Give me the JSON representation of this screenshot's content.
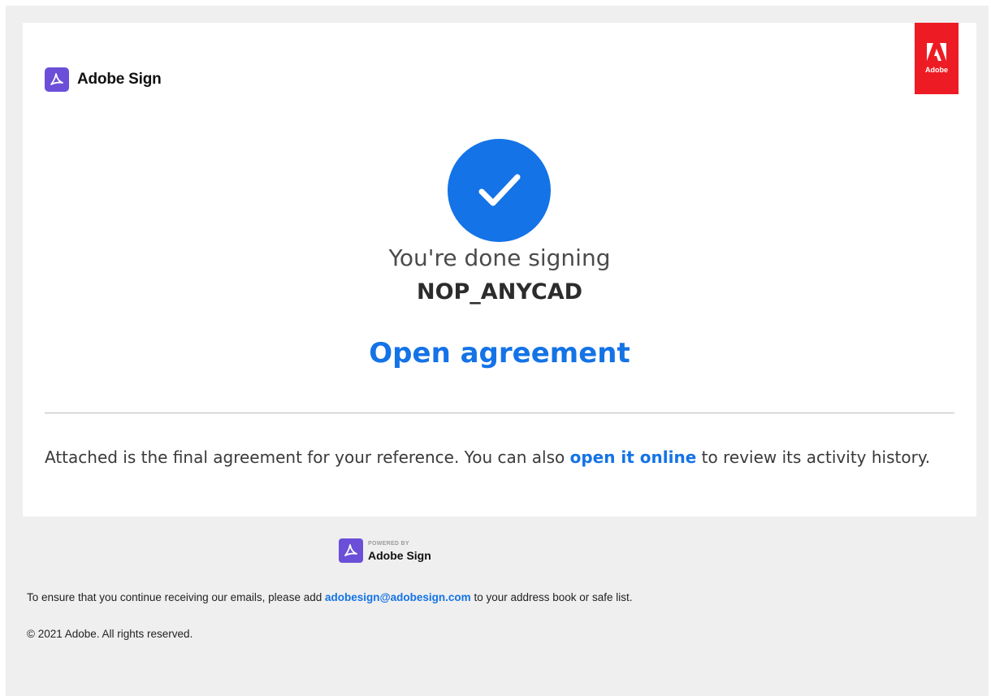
{
  "header": {
    "brand_name": "Adobe Sign",
    "brand_icon": "acrobat-sign-icon",
    "logo_text": "Adobe",
    "logo_icon": "adobe-logo-icon"
  },
  "main": {
    "status_icon": "check-circle-icon",
    "done_text": "You're done signing",
    "agreement_name": "NOP_ANYCAD",
    "open_agreement_label": "Open agreement",
    "message_prefix": "Attached is the final agreement for your reference. You can also",
    "message_link": "open it online",
    "message_suffix": "to review its activity history."
  },
  "footer": {
    "powered_by": "POWERED BY",
    "powered_name": "Adobe Sign",
    "note_prefix": "To ensure that you continue receiving our emails, please add",
    "note_email": "adobesign@adobesign.com",
    "note_suffix": "to your address book or safe list.",
    "copyright": "© 2021 Adobe. All rights reserved."
  },
  "colors": {
    "accent": "#1473e6",
    "brand_purple": "#6b4fd8",
    "adobe_red": "#ed1c24",
    "background": "#efefef"
  }
}
